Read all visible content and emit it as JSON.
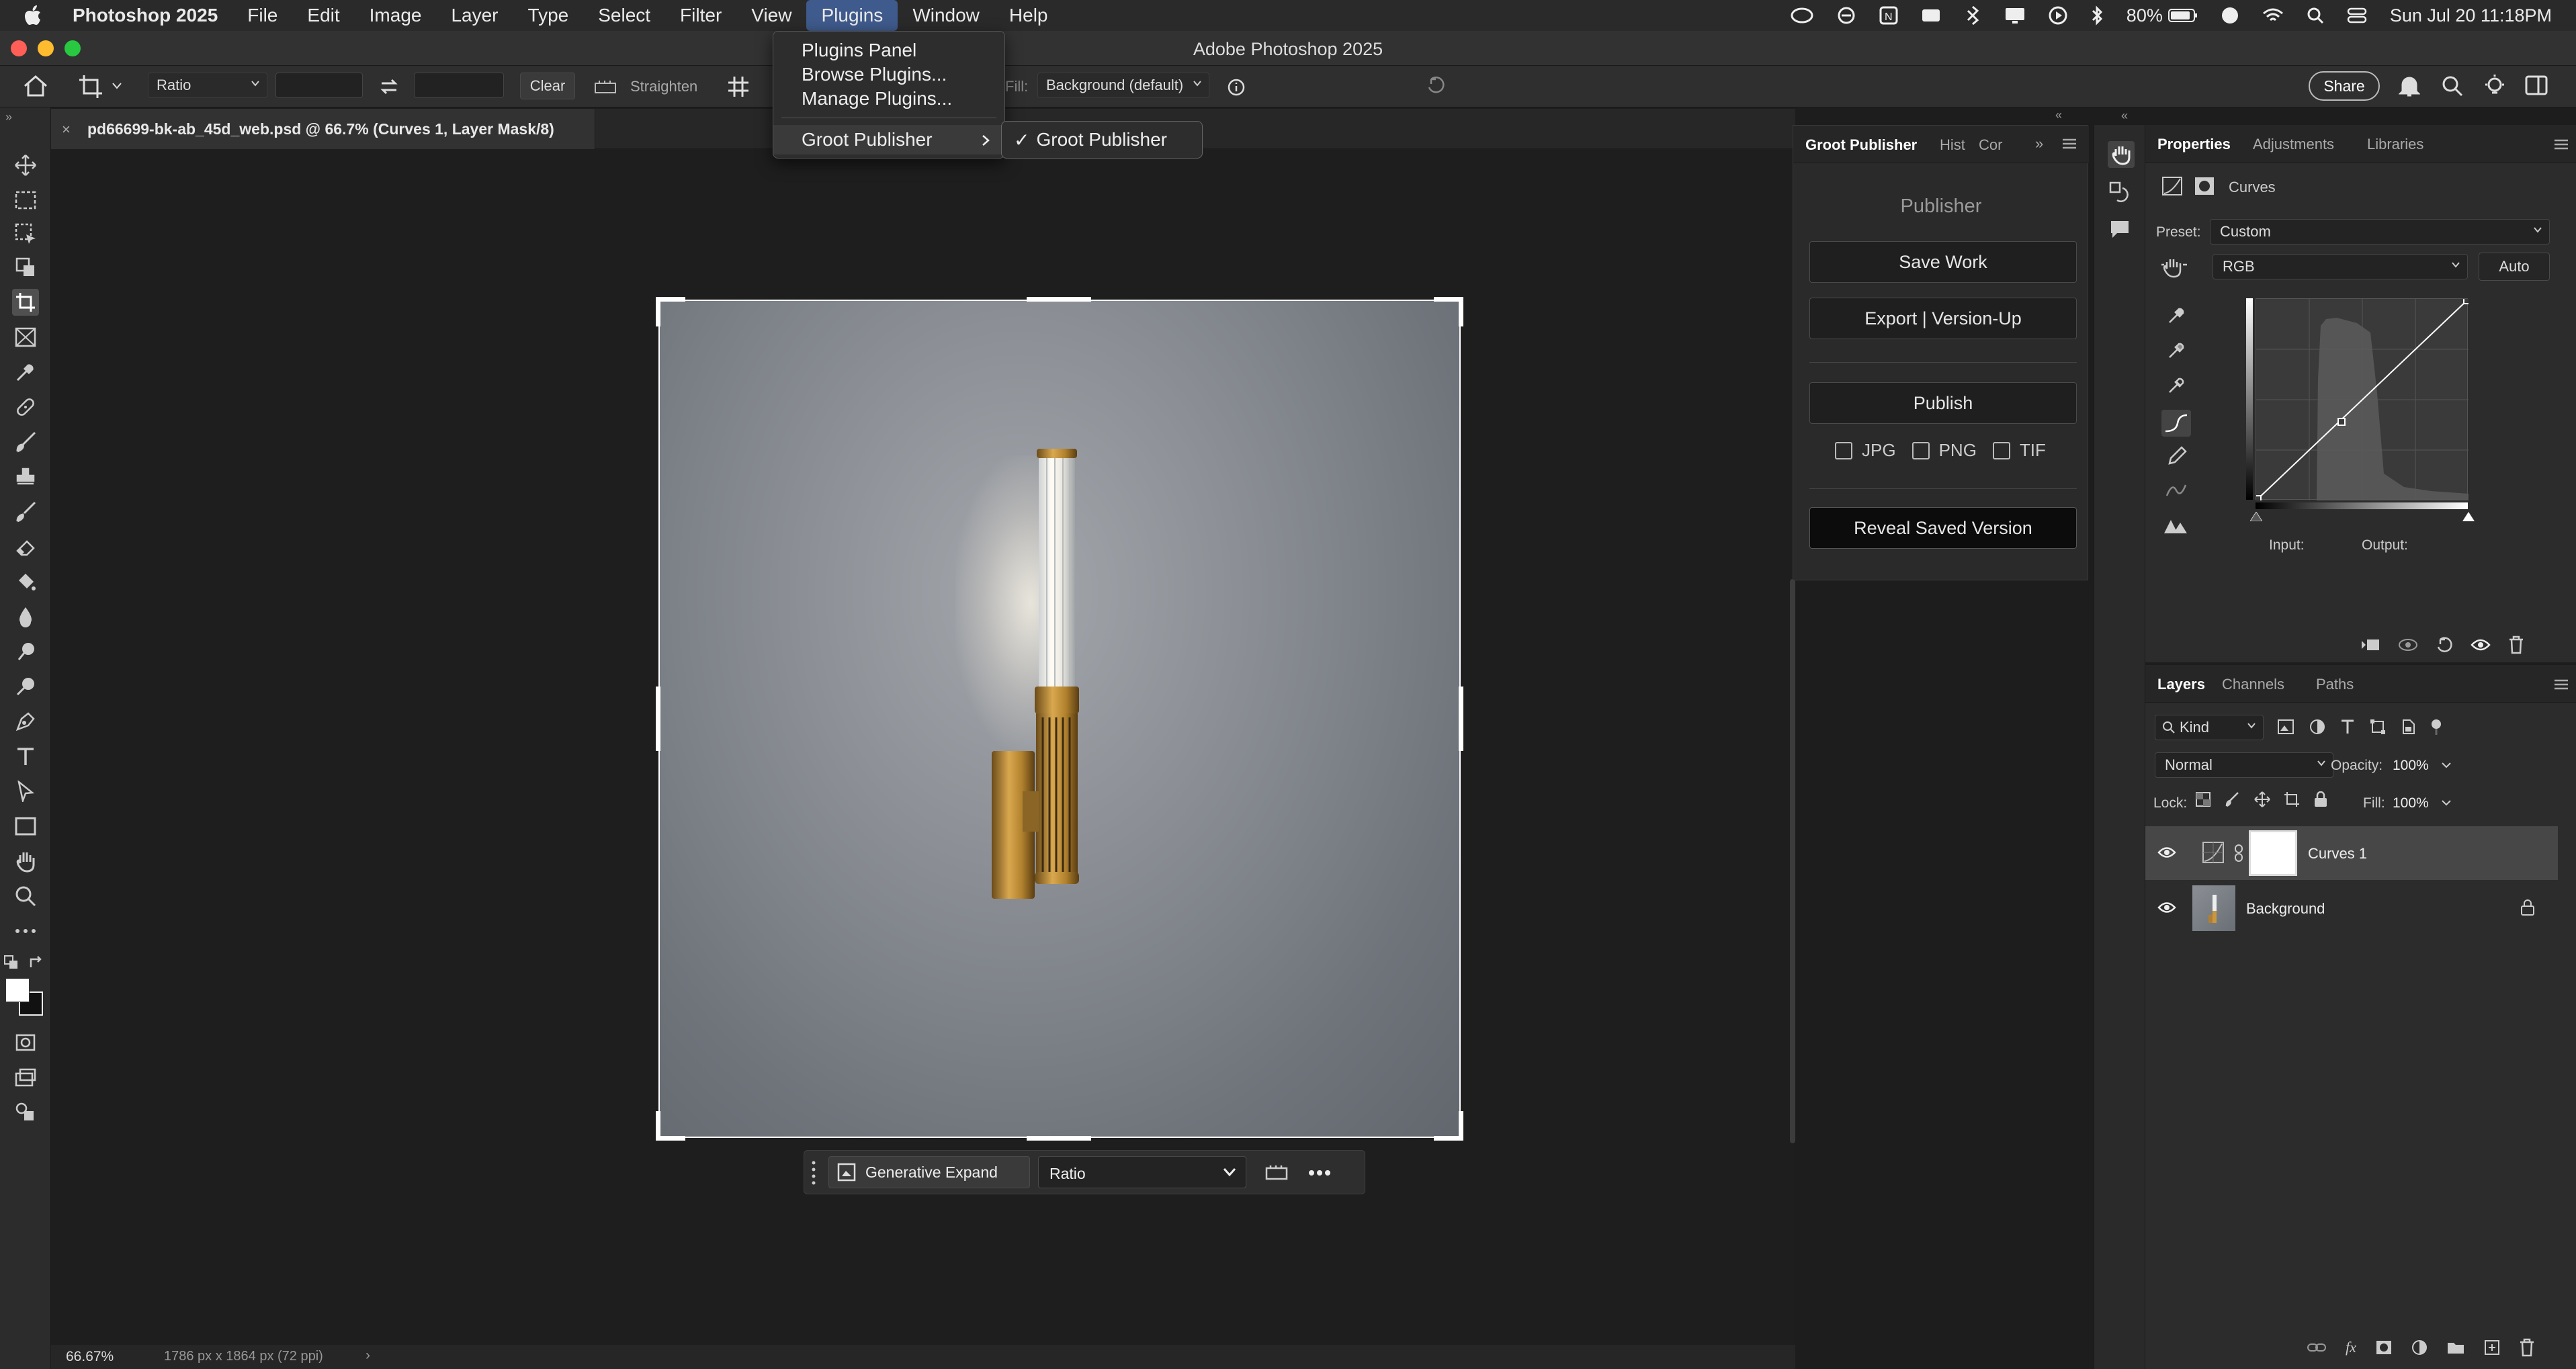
{
  "menubar": {
    "app_name": "Photoshop 2025",
    "items": [
      "File",
      "Edit",
      "Image",
      "Layer",
      "Type",
      "Select",
      "Filter",
      "View",
      "Plugins",
      "Window",
      "Help"
    ],
    "active_item": "Plugins",
    "status": {
      "battery": "80%",
      "datetime": "Sun Jul 20  11:18PM"
    }
  },
  "titlebar": {
    "title": "Adobe Photoshop 2025"
  },
  "options_bar": {
    "ratio_label": "Ratio",
    "clear_label": "Clear",
    "straighten_label": "Straighten",
    "fill_label": "Fill:",
    "fill_value": "Background (default)",
    "share_label": "Share"
  },
  "plugins_menu": {
    "items": [
      "Plugins Panel",
      "Browse Plugins...",
      "Manage Plugins..."
    ],
    "groot_item": "Groot Publisher",
    "submenu_item": "Groot Publisher"
  },
  "document": {
    "tab_title": "pd66699-bk-ab_45d_web.psd @ 66.7% (Curves 1, Layer Mask/8)",
    "zoom": "66.67%",
    "info": "1786 px x 1864 px (72 ppi)"
  },
  "context_bar": {
    "generative_expand": "Generative Expand",
    "ratio": "Ratio"
  },
  "groot_panel": {
    "tabs": [
      "Groot Publisher",
      "Hist",
      "Cor"
    ],
    "title": "Publisher",
    "save_work": "Save Work",
    "export": "Export | Version-Up",
    "publish": "Publish",
    "formats": [
      "JPG",
      "PNG",
      "TIF"
    ],
    "reveal": "Reveal Saved Version"
  },
  "properties_panel": {
    "tabs": [
      "Properties",
      "Adjustments",
      "Libraries"
    ],
    "type": "Curves",
    "preset_label": "Preset:",
    "preset_value": "Custom",
    "channel_value": "RGB",
    "auto_label": "Auto",
    "input_label": "Input:",
    "output_label": "Output:"
  },
  "layers_panel": {
    "tabs": [
      "Layers",
      "Channels",
      "Paths"
    ],
    "kind_label": "Kind",
    "blend_mode": "Normal",
    "opacity_label": "Opacity:",
    "opacity_value": "100%",
    "lock_label": "Lock:",
    "fill_label": "Fill:",
    "fill_value": "100%",
    "layers": [
      {
        "name": "Curves 1",
        "selected": true
      },
      {
        "name": "Background",
        "selected": false,
        "locked": true
      }
    ]
  },
  "colors": {
    "accent": "#3f5a8c",
    "canvas_bg": "#1e1e1e",
    "panel_bg": "#2c2c2c"
  }
}
